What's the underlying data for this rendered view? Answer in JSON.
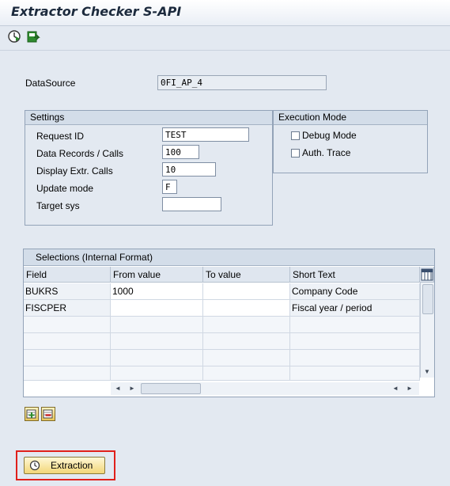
{
  "window": {
    "title": "Extractor Checker S-API"
  },
  "toolbar": {
    "icons": [
      "execute-icon",
      "save-variant-icon"
    ]
  },
  "datasource": {
    "label": "DataSource",
    "value": "0FI_AP_4"
  },
  "settings": {
    "title": "Settings",
    "request_id": {
      "label": "Request ID",
      "value": "TEST"
    },
    "records_calls": {
      "label": "Data Records / Calls",
      "value": "100"
    },
    "display_calls": {
      "label": "Display Extr. Calls",
      "value": "10"
    },
    "update_mode": {
      "label": "Update mode",
      "value": "F"
    },
    "target_sys": {
      "label": "Target sys",
      "value": ""
    }
  },
  "execution_mode": {
    "title": "Execution Mode",
    "debug_mode": {
      "label": "Debug Mode",
      "checked": false
    },
    "auth_trace": {
      "label": "Auth. Trace",
      "checked": false
    }
  },
  "selections": {
    "title": "Selections (Internal Format)",
    "columns": [
      "Field",
      "From value",
      "To value",
      "Short Text"
    ],
    "rows": [
      {
        "field": "BUKRS",
        "from": "1000",
        "to": "",
        "text": "Company Code"
      },
      {
        "field": "FISCPER",
        "from": "",
        "to": "",
        "text": "Fiscal year / period"
      }
    ]
  },
  "actions": {
    "extraction_label": "Extraction"
  },
  "colors": {
    "highlight": "#e0201b",
    "accent": "#f2d678"
  }
}
